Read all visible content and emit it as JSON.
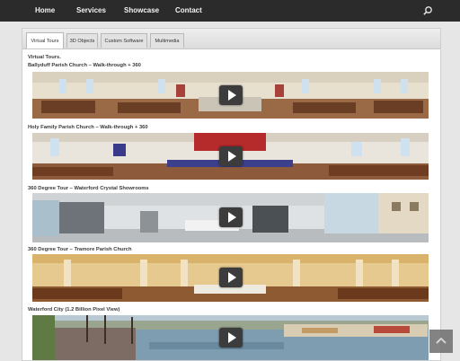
{
  "nav": {
    "items": [
      {
        "label": "Home"
      },
      {
        "label": "Services"
      },
      {
        "label": "Showcase"
      },
      {
        "label": "Contact"
      }
    ]
  },
  "tabs": [
    {
      "label": "Virtual Tours",
      "active": true
    },
    {
      "label": "3D Objects",
      "active": false
    },
    {
      "label": "Custom Software",
      "active": false
    },
    {
      "label": "Multimedia",
      "active": false
    }
  ],
  "main": {
    "heading": "Virtual Tours.",
    "tours": [
      {
        "title": "Ballyduff Parish Church – Walk-through + 360"
      },
      {
        "title": "Holy Family Parish Church – Walk-through + 360"
      },
      {
        "title": "360 Degree Tour – Waterford Crystal Showrooms"
      },
      {
        "title": "360 Degree Tour – Tramore Parish Church"
      },
      {
        "title": "Waterford City (1.2 Billion Pixel View)"
      }
    ]
  },
  "icons": {
    "search": "search-icon",
    "play": "play-icon",
    "scroll_top": "scroll-to-top-icon"
  },
  "colors": {
    "nav_bg": "#2b2b2b",
    "page_bg": "#e6e6e6",
    "panel_bg": "#ffffff"
  }
}
